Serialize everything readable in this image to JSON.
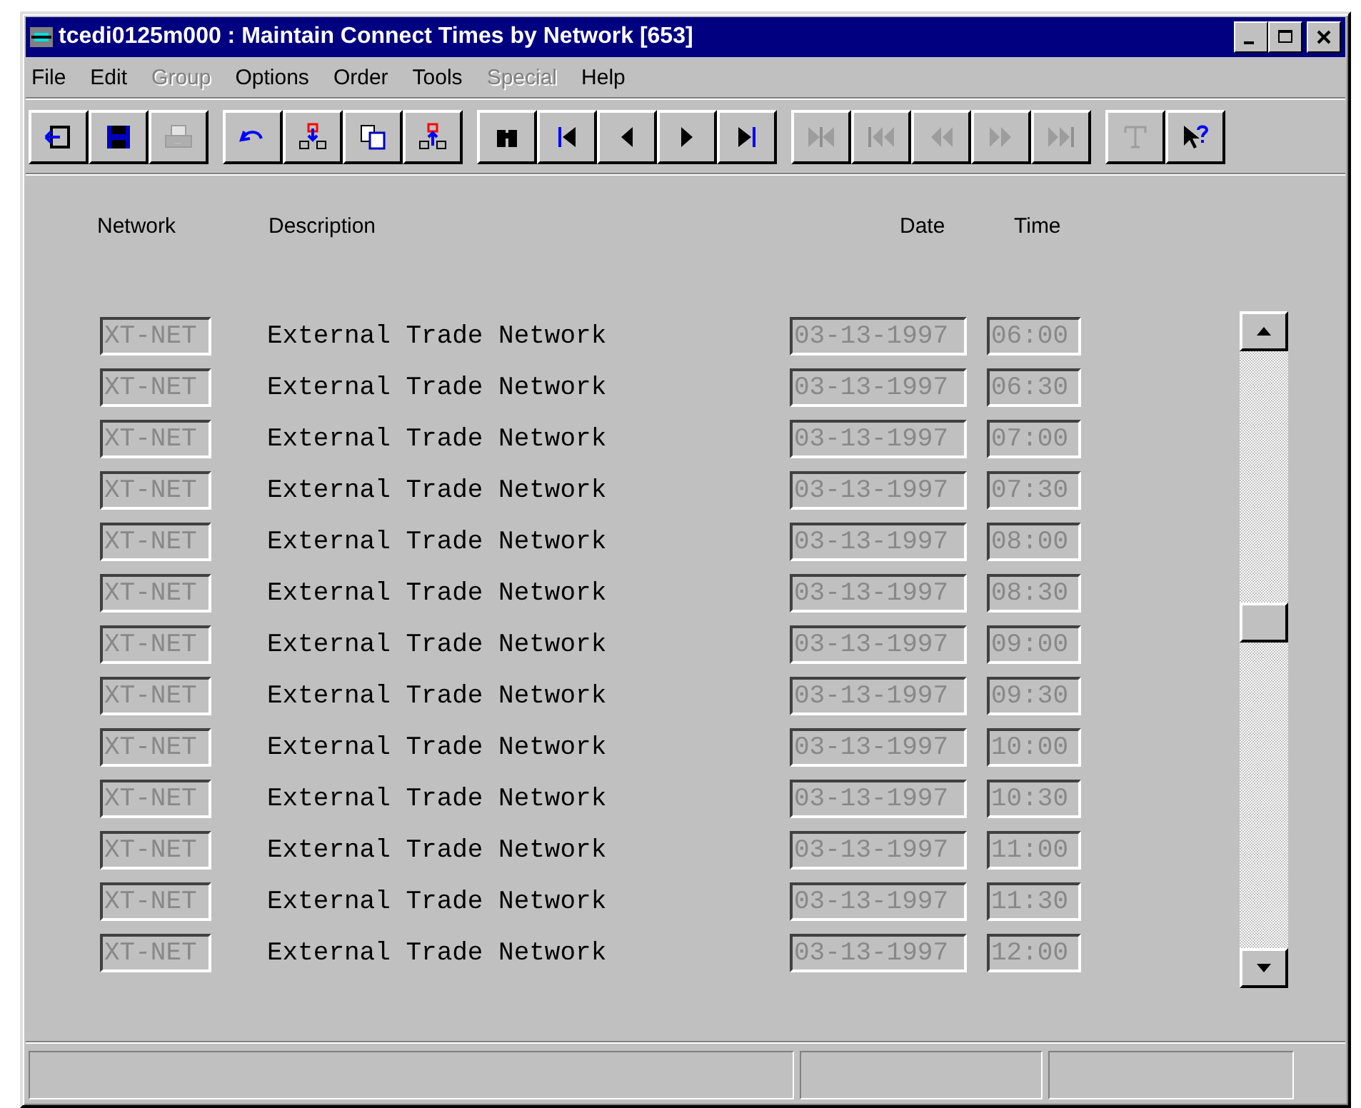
{
  "window": {
    "title": "tcedi0125m000 : Maintain Connect Times by Network [653]"
  },
  "menu": [
    {
      "label": "File",
      "disabled": false
    },
    {
      "label": "Edit",
      "disabled": false
    },
    {
      "label": "Group",
      "disabled": true
    },
    {
      "label": "Options",
      "disabled": false
    },
    {
      "label": "Order",
      "disabled": false
    },
    {
      "label": "Tools",
      "disabled": false
    },
    {
      "label": "Special",
      "disabled": true
    },
    {
      "label": "Help",
      "disabled": false
    }
  ],
  "toolbar": [
    [
      {
        "kind": "exit",
        "disabled": false
      },
      {
        "kind": "save",
        "disabled": false
      },
      {
        "kind": "print",
        "disabled": true
      }
    ],
    [
      {
        "kind": "undo",
        "disabled": false
      },
      {
        "kind": "insert",
        "disabled": false
      },
      {
        "kind": "copy",
        "disabled": false
      },
      {
        "kind": "extract",
        "disabled": false
      }
    ],
    [
      {
        "kind": "find",
        "disabled": false
      },
      {
        "kind": "first",
        "disabled": false
      },
      {
        "kind": "prev",
        "disabled": false
      },
      {
        "kind": "next",
        "disabled": false
      },
      {
        "kind": "last",
        "disabled": false
      }
    ],
    [
      {
        "kind": "first-group",
        "disabled": true
      },
      {
        "kind": "first-set",
        "disabled": true
      },
      {
        "kind": "prev-set",
        "disabled": true
      },
      {
        "kind": "next-set",
        "disabled": true
      },
      {
        "kind": "last-set",
        "disabled": true
      }
    ],
    [
      {
        "kind": "text",
        "disabled": true
      },
      {
        "kind": "help",
        "disabled": false
      }
    ]
  ],
  "columns": [
    "Network",
    "Description",
    "Date",
    "Time"
  ],
  "rows": [
    {
      "network": "XT-NET",
      "description": "External Trade Network",
      "date": "03-13-1997",
      "time": "06:00"
    },
    {
      "network": "XT-NET",
      "description": "External Trade Network",
      "date": "03-13-1997",
      "time": "06:30"
    },
    {
      "network": "XT-NET",
      "description": "External Trade Network",
      "date": "03-13-1997",
      "time": "07:00"
    },
    {
      "network": "XT-NET",
      "description": "External Trade Network",
      "date": "03-13-1997",
      "time": "07:30"
    },
    {
      "network": "XT-NET",
      "description": "External Trade Network",
      "date": "03-13-1997",
      "time": "08:00"
    },
    {
      "network": "XT-NET",
      "description": "External Trade Network",
      "date": "03-13-1997",
      "time": "08:30"
    },
    {
      "network": "XT-NET",
      "description": "External Trade Network",
      "date": "03-13-1997",
      "time": "09:00"
    },
    {
      "network": "XT-NET",
      "description": "External Trade Network",
      "date": "03-13-1997",
      "time": "09:30"
    },
    {
      "network": "XT-NET",
      "description": "External Trade Network",
      "date": "03-13-1997",
      "time": "10:00"
    },
    {
      "network": "XT-NET",
      "description": "External Trade Network",
      "date": "03-13-1997",
      "time": "10:30"
    },
    {
      "network": "XT-NET",
      "description": "External Trade Network",
      "date": "03-13-1997",
      "time": "11:00"
    },
    {
      "network": "XT-NET",
      "description": "External Trade Network",
      "date": "03-13-1997",
      "time": "11:30"
    },
    {
      "network": "XT-NET",
      "description": "External Trade Network",
      "date": "03-13-1997",
      "time": "12:00"
    }
  ]
}
